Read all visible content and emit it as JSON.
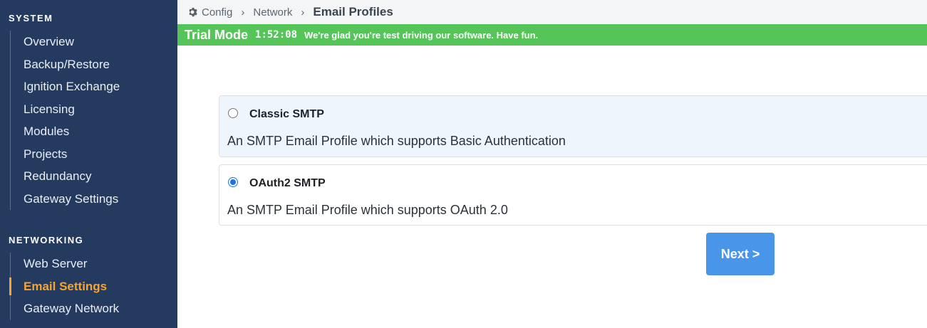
{
  "sidebar": {
    "system_title": "SYSTEM",
    "system_items": [
      {
        "label": "Overview"
      },
      {
        "label": "Backup/Restore"
      },
      {
        "label": "Ignition Exchange"
      },
      {
        "label": "Licensing"
      },
      {
        "label": "Modules"
      },
      {
        "label": "Projects"
      },
      {
        "label": "Redundancy"
      },
      {
        "label": "Gateway Settings"
      }
    ],
    "networking_title": "NETWORKING",
    "networking_items": [
      {
        "label": "Web Server"
      },
      {
        "label": "Email Settings",
        "active": true
      },
      {
        "label": "Gateway Network"
      }
    ]
  },
  "breadcrumb": {
    "icon": "gear-icon",
    "items": [
      "Config",
      "Network"
    ],
    "current": "Email Profiles"
  },
  "trial": {
    "title": "Trial Mode",
    "time": "1:52:08",
    "message": "We're glad you're test driving our software. Have fun."
  },
  "options": [
    {
      "title": "Classic SMTP",
      "description": "An SMTP Email Profile which supports Basic Authentication",
      "selected": false
    },
    {
      "title": "OAuth2 SMTP",
      "description": "An SMTP Email Profile which supports OAuth 2.0",
      "selected": true
    }
  ],
  "next_label": "Next >",
  "colors": {
    "sidebar_bg": "#243a5e",
    "active_nav": "#f5a52f",
    "trial_bg": "#55c55a",
    "button_bg": "#4895ea",
    "radio_accent": "#1a73e8"
  }
}
